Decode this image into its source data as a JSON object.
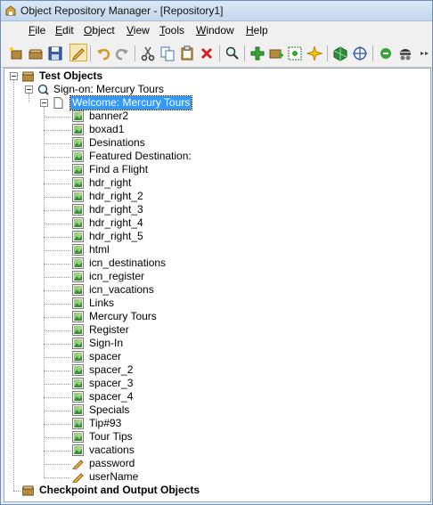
{
  "window": {
    "title": "Object Repository Manager - [Repository1]"
  },
  "menu": [
    {
      "label": "File",
      "u": "F",
      "rest": "ile"
    },
    {
      "label": "Edit",
      "u": "E",
      "rest": "dit"
    },
    {
      "label": "Object",
      "u": "O",
      "rest": "bject"
    },
    {
      "label": "View",
      "u": "V",
      "rest": "iew"
    },
    {
      "label": "Tools",
      "u": "T",
      "rest": "ools"
    },
    {
      "label": "Window",
      "u": "W",
      "rest": "indow"
    },
    {
      "label": "Help",
      "u": "H",
      "rest": "elp"
    }
  ],
  "tree": {
    "root1": "Test Objects",
    "browser": "Sign-on: Mercury Tours",
    "page": "Welcome: Mercury Tours",
    "children": [
      "banner2",
      "boxad1",
      "Desinations",
      "Featured Destination:",
      "Find a Flight",
      "hdr_right",
      "hdr_right_2",
      "hdr_right_3",
      "hdr_right_4",
      "hdr_right_5",
      "html",
      "icn_destinations",
      "icn_register",
      "icn_vacations",
      "Links",
      "Mercury Tours",
      "Register",
      "Sign-In",
      "spacer",
      "spacer_2",
      "spacer_3",
      "spacer_4",
      "Specials",
      "Tip#93",
      "Tour Tips",
      "vacations"
    ],
    "edit_children": [
      "password",
      "userName"
    ],
    "root2": "Checkpoint and Output Objects"
  },
  "colors": {
    "selection": "#3399ff",
    "titlebar": "#c5d7ee"
  }
}
